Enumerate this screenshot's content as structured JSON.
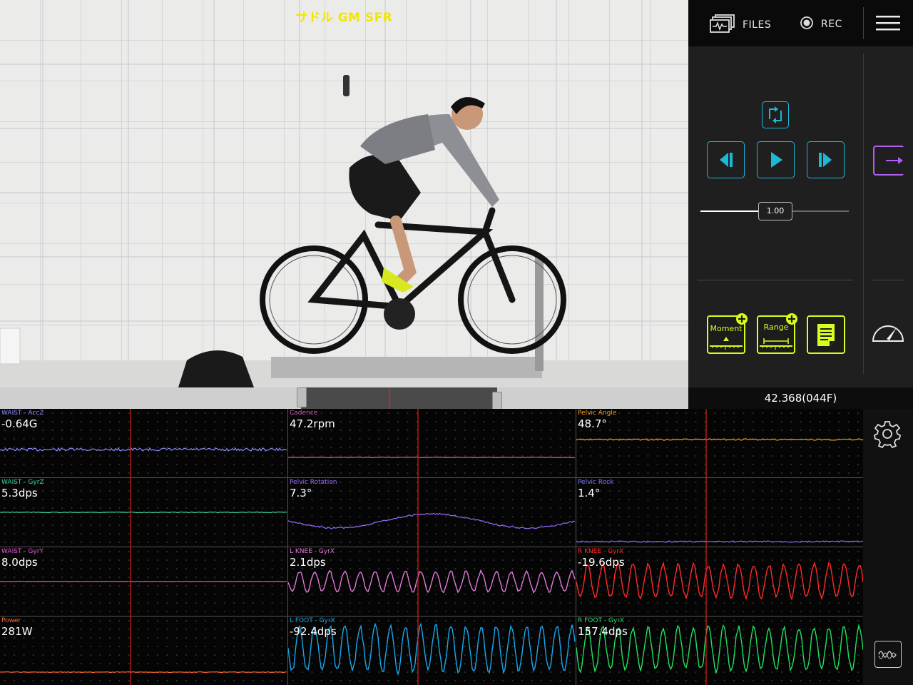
{
  "video": {
    "overlay_title": "サドル GM SFR"
  },
  "toolbar": {
    "files_label": "FILES",
    "rec_label": "REC"
  },
  "playback": {
    "speed": "1.00",
    "timestamp": "42.368(044F)"
  },
  "tools": {
    "moment_label": "Moment",
    "range_label": "Range"
  },
  "colors": {
    "accent_cyan": "#1bb8d8",
    "accent_lime": "#d6ff1c",
    "accent_purple": "#b05ff0",
    "cursor_red": "#e01b1b"
  },
  "graphs": [
    {
      "title": "WAIST - AccZ",
      "value": "-0.64G",
      "color": "#8c8cff"
    },
    {
      "title": "Cadence",
      "value": "47.2rpm",
      "color": "#d65ab8"
    },
    {
      "title": "Pelvic Angle",
      "value": "48.7°",
      "color": "#ff9a1a"
    },
    {
      "title": "WAIST - GyrZ",
      "value": "5.3dps",
      "color": "#3fd3a8"
    },
    {
      "title": "Pelvic Rotation",
      "value": "7.3°",
      "color": "#9a6cff"
    },
    {
      "title": "Pelvic Rock",
      "value": "1.4°",
      "color": "#7a7cff"
    },
    {
      "title": "WAIST - GyrY",
      "value": "8.0dps",
      "color": "#e05ad0"
    },
    {
      "title": "L KNEE - GyrX",
      "value": "2.1dps",
      "color": "#e07ad6"
    },
    {
      "title": "R KNEE - GyrX",
      "value": "-19.6dps",
      "color": "#ff2a2a"
    },
    {
      "title": "Power",
      "value": "281W",
      "color": "#ff6a2a"
    },
    {
      "title": "L FOOT - GyrX",
      "value": "-92.4dps",
      "color": "#18a8ee"
    },
    {
      "title": "R FOOT - GyrX",
      "value": "157.4dps",
      "color": "#22e060"
    }
  ]
}
